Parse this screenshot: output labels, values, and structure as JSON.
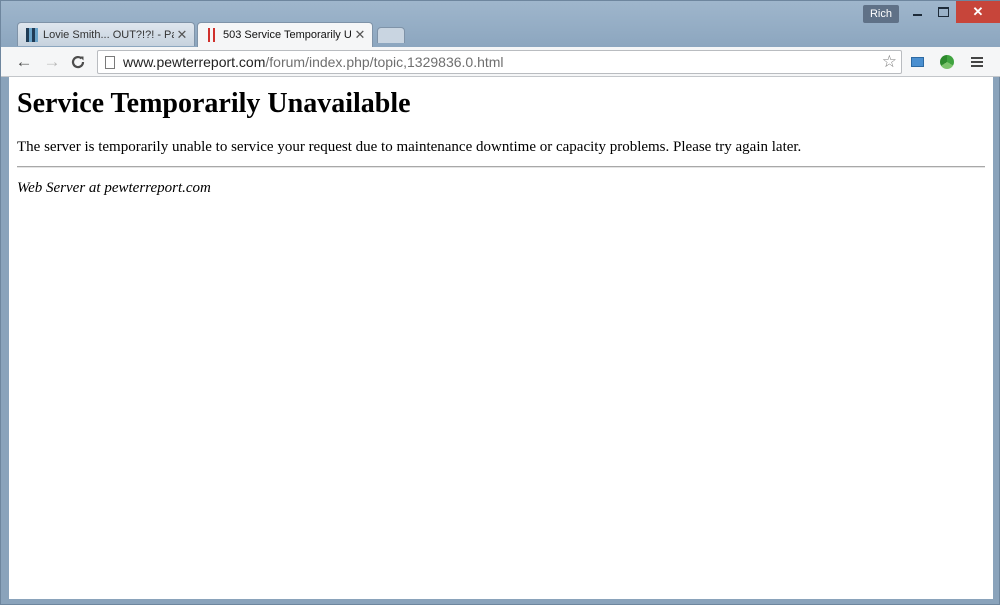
{
  "window": {
    "user_name": "Rich",
    "controls": {
      "minimize": "minimize",
      "maximize": "maximize",
      "close": "✕"
    }
  },
  "tabs": [
    {
      "title": "Lovie Smith... OUT?!?! - Pa",
      "favicon": "site-favicon-blue",
      "active": false,
      "close": "✕"
    },
    {
      "title": "503 Service Temporarily U",
      "favicon": "site-favicon-red",
      "active": true,
      "close": "✕"
    }
  ],
  "toolbar": {
    "back": "←",
    "forward": "→",
    "reload": "C",
    "url_host": "www.pewterreport.com",
    "url_path": "/forum/index.php/topic,1329836.0.html",
    "bookmark_star": "☆",
    "extensions": [
      "folder-icon",
      "recycle-icon"
    ],
    "menu": "hamburger-menu-icon"
  },
  "page": {
    "heading": "Service Temporarily Unavailable",
    "message": "The server is temporarily unable to service your request due to maintenance downtime or capacity problems. Please try again later.",
    "footer": "Web Server at pewterreport.com"
  }
}
